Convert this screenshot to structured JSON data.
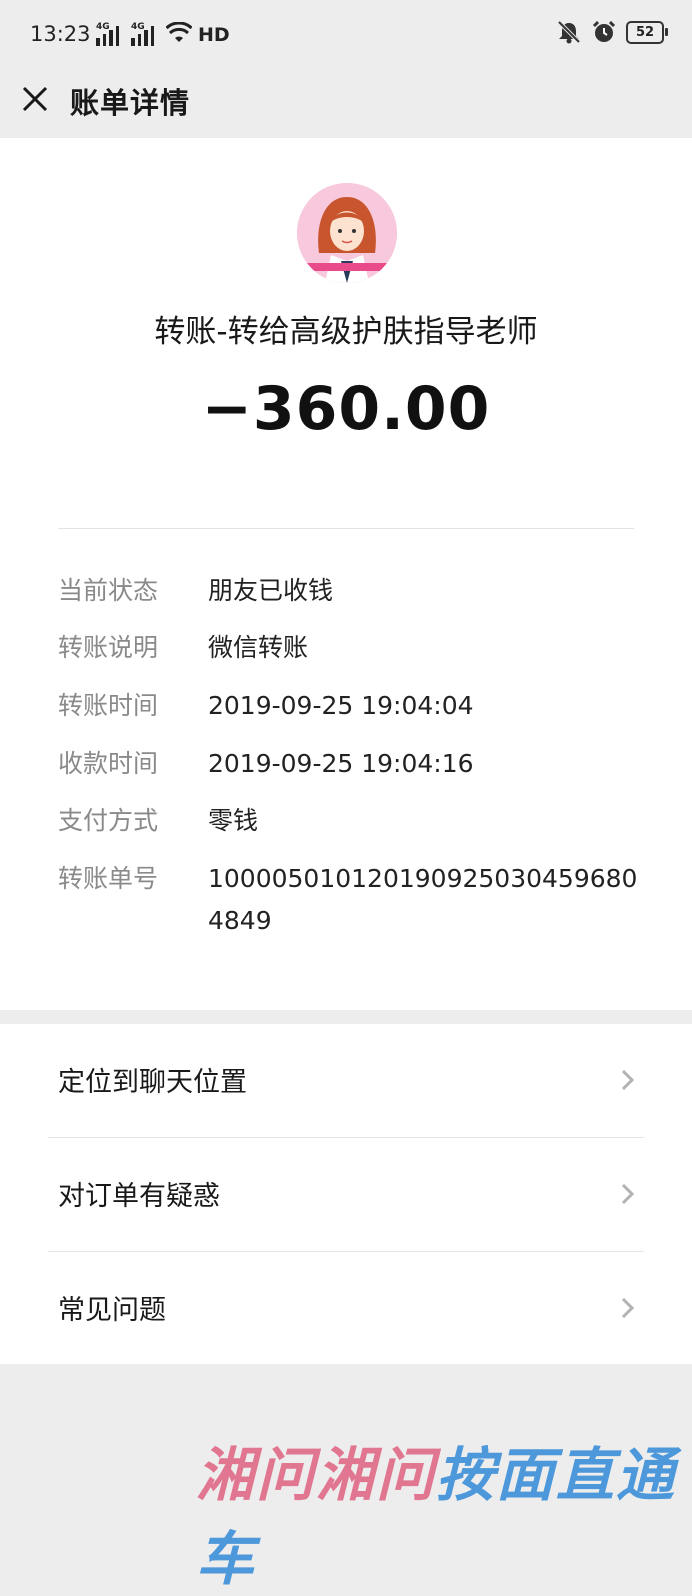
{
  "status_bar": {
    "time": "13:23",
    "network_tags": [
      "4G",
      "4G"
    ],
    "hd_label": "HD",
    "battery": "52"
  },
  "nav": {
    "title": "账单详情",
    "close_icon": "close-icon"
  },
  "transaction": {
    "payee": "转账-转给高级护肤指导老师",
    "amount": "−360.00",
    "details": [
      {
        "label": "当前状态",
        "value": "朋友已收钱"
      },
      {
        "label": "转账说明",
        "value": "微信转账"
      },
      {
        "label": "转账时间",
        "value": "2019-09-25 19:04:04"
      },
      {
        "label": "收款时间",
        "value": "2019-09-25 19:04:16"
      },
      {
        "label": "支付方式",
        "value": "零钱"
      },
      {
        "label": "转账单号",
        "value": "1000050101201909250304596804849"
      }
    ]
  },
  "options": [
    {
      "label": "定位到聊天位置"
    },
    {
      "label": "对订单有疑惑"
    },
    {
      "label": "常见问题"
    }
  ],
  "watermark": {
    "part1": "湘问",
    "part2": "湘问",
    "part3": "按面直通车"
  },
  "colors": {
    "background": "#ededed",
    "card": "#ffffff",
    "label_gray": "#8a8a8a",
    "avatar_pink": "#f8c8dc"
  }
}
